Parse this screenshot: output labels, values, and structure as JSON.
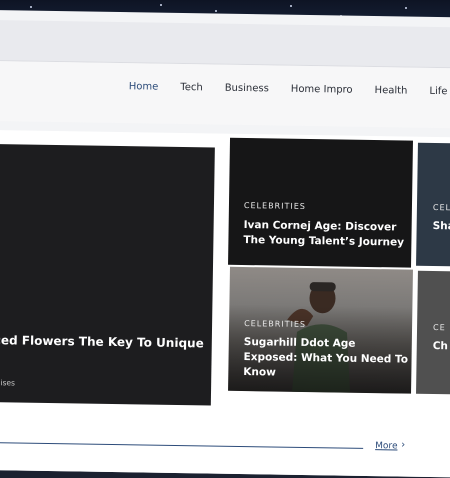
{
  "nav": {
    "items": [
      {
        "label": "Home",
        "active": true
      },
      {
        "label": "Tech",
        "active": false
      },
      {
        "label": "Business",
        "active": false
      },
      {
        "label": "Home Impro",
        "active": false
      },
      {
        "label": "Health",
        "active": false
      },
      {
        "label": "Life St",
        "active": false
      }
    ]
  },
  "featured": {
    "title": "ced Flowers The Key To Unique",
    "meta": "mises"
  },
  "cards": [
    {
      "category": "CELEBRITIES",
      "title": "Ivan Cornej Age: Discover The Young Talent’s Journey"
    },
    {
      "category": "CELEBRITIES",
      "title": "Sugarhill Ddot Age Exposed: What You Need To Know"
    },
    {
      "category": "CEL",
      "title": "Sha Ho"
    },
    {
      "category": "CE",
      "title": "Ch Th"
    }
  ],
  "more": {
    "label": "More",
    "icon": "chevron-right-icon"
  },
  "colors": {
    "accent": "#2d4c7a",
    "card_dark": "#161617"
  }
}
